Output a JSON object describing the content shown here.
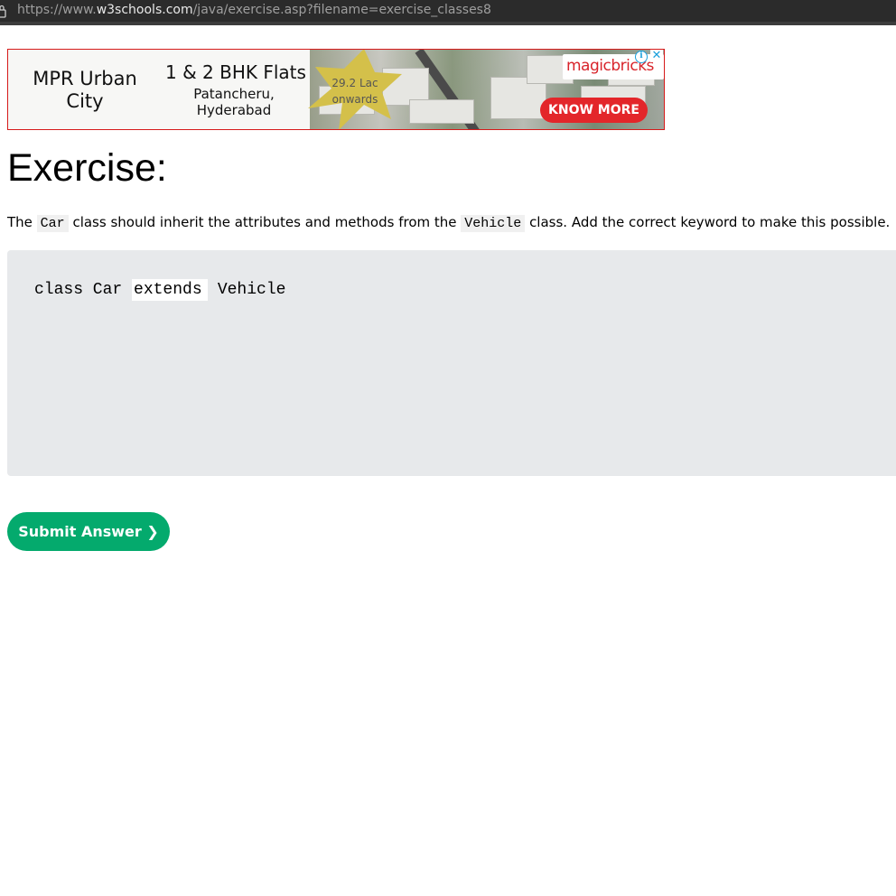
{
  "browser": {
    "url_scheme": "https://www.",
    "url_host": "w3schools.com",
    "url_path": "/java/exercise.asp?filename=exercise_classes8"
  },
  "ad": {
    "brand": "MPR Urban City",
    "headline": "1 & 2 BHK Flats",
    "location": "Patancheru, Hyderabad",
    "price": "29.2 Lac onwards",
    "logo": "magicbricks",
    "cta_label": "KNOW MORE",
    "info_icon": "i",
    "close_icon": "✕",
    "colors": {
      "border": "#d61a1a",
      "cta": "#e3262a",
      "star": "#d4c04a",
      "adchoices": "#1aa0dc"
    }
  },
  "exercise": {
    "title": "Exercise:",
    "instructions": {
      "part1": "The ",
      "code1": "Car",
      "part2": " class should inherit the attributes and methods from the ",
      "code2": "Vehicle",
      "part3": " class. Add the correct keyword to make this possible."
    },
    "code": {
      "before": "class Car ",
      "input_value": "extends",
      "after": " Vehicle"
    },
    "submit_label": "Submit Answer ❯",
    "colors": {
      "code_bg": "#e7e9eb",
      "submit_bg": "#04aa6d"
    }
  }
}
